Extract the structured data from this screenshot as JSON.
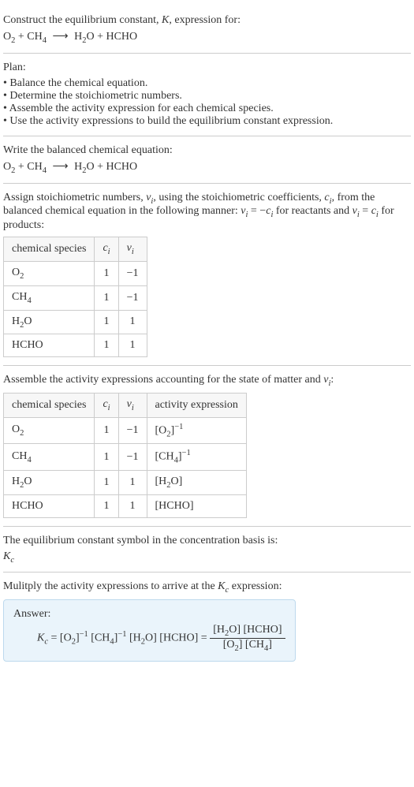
{
  "intro": {
    "prompt": "Construct the equilibrium constant, ",
    "K": "K",
    "prompt2": ", expression for:"
  },
  "reaction": {
    "r1": "O",
    "r1sub": "2",
    "plus": " + ",
    "r2": "CH",
    "r2sub": "4",
    "arrow": "⟶",
    "p1": "H",
    "p1sub": "2",
    "p1b": "O",
    "p2": "HCHO"
  },
  "plan": {
    "title": "Plan:",
    "items": [
      "Balance the chemical equation.",
      "Determine the stoichiometric numbers.",
      "Assemble the activity expression for each chemical species.",
      "Use the activity expressions to build the equilibrium constant expression."
    ]
  },
  "balanced": {
    "title": "Write the balanced chemical equation:"
  },
  "assign": {
    "text1": "Assign stoichiometric numbers, ",
    "nu": "ν",
    "sub_i": "i",
    "text2": ", using the stoichiometric coefficients, ",
    "c": "c",
    "text3": ", from the balanced chemical equation in the following manner: ",
    "eq_reactants": " = −",
    "text4": " for reactants and ",
    "eq_products": " = ",
    "text5": " for products:"
  },
  "table1": {
    "headers": {
      "species": "chemical species",
      "c": "c",
      "nu": "ν",
      "sub_i": "i"
    },
    "rows": [
      {
        "species_main": "O",
        "species_sub": "2",
        "c": "1",
        "nu": "−1"
      },
      {
        "species_main": "CH",
        "species_sub": "4",
        "c": "1",
        "nu": "−1"
      },
      {
        "species_main": "H",
        "species_sub": "2",
        "species_after": "O",
        "c": "1",
        "nu": "1"
      },
      {
        "species_main": "HCHO",
        "species_sub": "",
        "c": "1",
        "nu": "1"
      }
    ]
  },
  "assemble": {
    "text1": "Assemble the activity expressions accounting for the state of matter and ",
    "text2": ":"
  },
  "table2": {
    "headers": {
      "species": "chemical species",
      "c": "c",
      "nu": "ν",
      "sub_i": "i",
      "activity": "activity expression"
    },
    "rows": [
      {
        "species_main": "O",
        "species_sub": "2",
        "c": "1",
        "nu": "−1",
        "act_pre": "[O",
        "act_sub": "2",
        "act_post": "]",
        "act_exp": "−1"
      },
      {
        "species_main": "CH",
        "species_sub": "4",
        "c": "1",
        "nu": "−1",
        "act_pre": "[CH",
        "act_sub": "4",
        "act_post": "]",
        "act_exp": "−1"
      },
      {
        "species_main": "H",
        "species_sub": "2",
        "species_after": "O",
        "c": "1",
        "nu": "1",
        "act_pre": "[H",
        "act_sub": "2",
        "act_post": "O]",
        "act_exp": ""
      },
      {
        "species_main": "HCHO",
        "species_sub": "",
        "c": "1",
        "nu": "1",
        "act_pre": "[HCHO]",
        "act_sub": "",
        "act_post": "",
        "act_exp": ""
      }
    ]
  },
  "symbol": {
    "text": "The equilibrium constant symbol in the concentration basis is:",
    "K": "K",
    "sub_c": "c"
  },
  "multiply": {
    "text1": "Mulitply the activity expressions to arrive at the ",
    "text2": " expression:"
  },
  "answer": {
    "label": "Answer:",
    "eq_left": " = [O",
    "o2sub": "2",
    "bracket_close": "]",
    "exp_neg1": "−1",
    "ch4_open": " [CH",
    "ch4sub": "4",
    "h2o_open": " [H",
    "h2osub": "2",
    "h2o_close": "O] [HCHO] = ",
    "num_h2o": "[H",
    "num_h2o_close": "O] [HCHO]",
    "den_o2": "[O",
    "den_ch4": "] [CH",
    "den_close": "]"
  }
}
